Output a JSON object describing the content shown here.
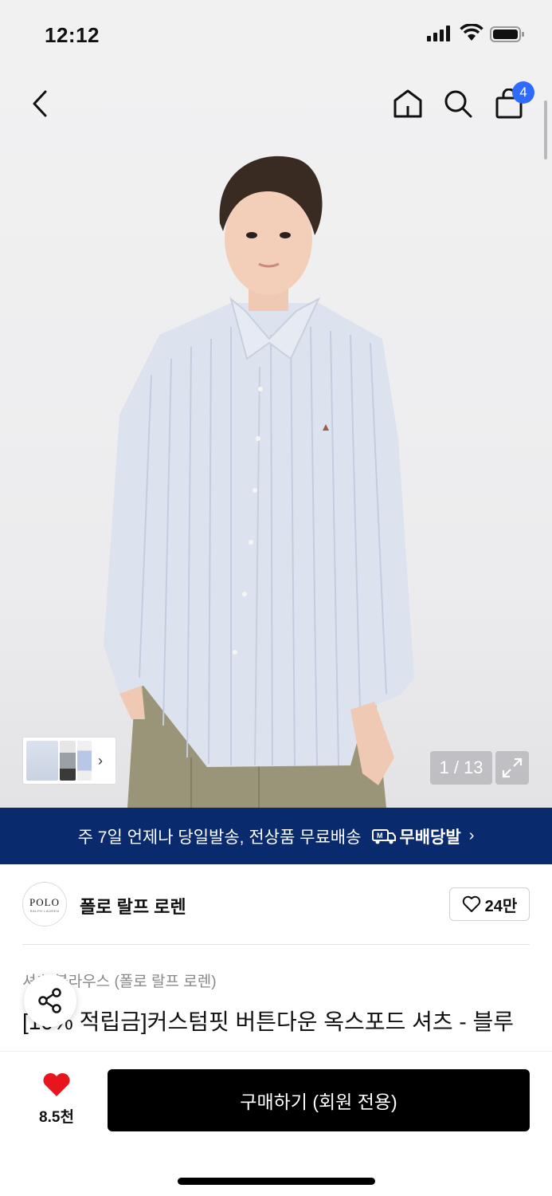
{
  "status_bar": {
    "time": "12:12"
  },
  "nav": {
    "cart_count": "4"
  },
  "gallery": {
    "counter": "1 / 13",
    "thumbs_chevron": "›"
  },
  "banner": {
    "text": "주 7일 언제나 당일발송, 전상품 무료배송",
    "logo_text": "무배당발",
    "chevron": "›"
  },
  "brand": {
    "logo_text": "POLO",
    "logo_sub": "RALPH LAUREN",
    "name": "폴로 랄프 로렌",
    "likes": "24만"
  },
  "product": {
    "category": "셔츠/블라우스 (폴로 랄프 로렌)",
    "title": "[10% 적립금]커스텀핏 버튼다운 옥스포드 셔츠 - 블루"
  },
  "bottom_bar": {
    "wish_count": "8.5천",
    "buy_label": "구매하기 (회원 전용)"
  },
  "colors": {
    "banner_bg": "#0a2a6e",
    "badge": "#2f6bff",
    "heart": "#e8141e",
    "buy_bg": "#000000"
  }
}
